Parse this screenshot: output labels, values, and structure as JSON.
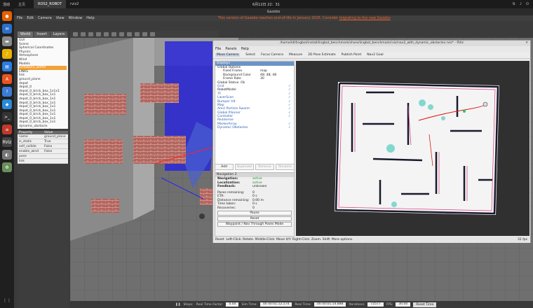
{
  "topbar": {
    "activities": "活动",
    "tabs": [
      {
        "label": "主页",
        "active": false
      },
      {
        "label": "ROS2_ROBOT",
        "active": true
      }
    ],
    "app_label": "rviz2",
    "clock": "6月12日 22：31"
  },
  "dock": {
    "apps": [
      {
        "icon": "firefox-icon",
        "color": "#e66000",
        "glyph": "●"
      },
      {
        "icon": "thunderbird-icon",
        "color": "#2a6fc9",
        "glyph": "✉"
      },
      {
        "icon": "files-icon",
        "color": "#8a8a8a",
        "glyph": "▬"
      },
      {
        "icon": "rhythmbox-icon",
        "color": "#e8b400",
        "glyph": "♪"
      },
      {
        "icon": "writer-icon",
        "color": "#2b7de0",
        "glyph": "▤"
      },
      {
        "icon": "app-center-icon",
        "color": "#e95420",
        "glyph": "A"
      },
      {
        "icon": "help-icon",
        "color": "#3b7bd6",
        "glyph": "?"
      },
      {
        "icon": "vscode-icon",
        "color": "#2c8ad8",
        "glyph": "◆"
      },
      {
        "icon": "terminal-icon",
        "color": "#333",
        "glyph": ">_"
      },
      {
        "icon": "layers-icon",
        "color": "#c0392b",
        "glyph": "≡"
      },
      {
        "icon": "rviz-icon",
        "color": "#444",
        "glyph": "RViz"
      },
      {
        "icon": "disk-icon",
        "color": "#777",
        "glyph": "◐"
      },
      {
        "icon": "trash-icon",
        "color": "#6a8f5a",
        "glyph": "♻"
      }
    ],
    "apps_grid": "⋮⋮"
  },
  "gazebo": {
    "title": "Gazebo",
    "menu": [
      "File",
      "Edit",
      "Camera",
      "View",
      "Window",
      "Help"
    ],
    "notice": "This version of Gazebo reaches end-of-life in January 2025. Consider",
    "notice_link": "migrating to the new Gazebo",
    "tabs": [
      "World",
      "Insert",
      "Layers"
    ],
    "tree": [
      "GUI",
      "Scene",
      "Spherical Coordinates",
      "Physics",
      "Atmosphere",
      "Wind",
      "Models",
      "turtlebot3_waffle",
      "LINKS",
      "link",
      "ground_plane",
      "depot",
      "depot_0",
      "depot_0_brick_box_1x1x1",
      "depot_0_brick_box_1x1",
      "depot_0_brick_box_1x1",
      "depot_0_brick_box_1x1",
      "depot_0_brick_box_1x1",
      "depot_0_brick_box_1x1",
      "depot_0_brick_box_1x1",
      "depot_0_brick_box_1x1",
      "depot_0_brick_box_1x1",
      "dynamic_obstacle",
      "dynamic_obstacle_0",
      "dynamic_obstacle_1"
    ],
    "highlighted_index": 7,
    "property_header": [
      "Property",
      "Value"
    ],
    "properties": [
      [
        "name",
        "ground_plane"
      ],
      [
        "is_static",
        "True"
      ],
      [
        "self_collide",
        "False"
      ],
      [
        "enable_wind",
        "False"
      ],
      [
        "pose",
        ""
      ],
      [
        "link",
        ""
      ]
    ],
    "status": {
      "steps_label": "Steps:",
      "rtf_label": "Real Time Factor:",
      "rtf": "0.00",
      "sim_label": "Sim Time:",
      "sim": "00 00:01:12.574",
      "real_label": "Real Time:",
      "real": "00 00:01:14.888",
      "iter_label": "Iterations:",
      "iter": "72577",
      "fps_label": "FPS:",
      "fps": "30.00",
      "reset": "Reset Time"
    }
  },
  "rviz": {
    "title": "/home/ldl/lingbot/install/lingbot_benchmark/share/lingbot_benchmark/rviz/nav2_with_dynamic_obstacles.rviz* - RViz",
    "menu": [
      "File",
      "Panels",
      "Help"
    ],
    "tools": [
      "Move Camera",
      "Select",
      "Focus Camera",
      "Measure",
      "2D Pose Estimate",
      "Publish Point",
      "Nav2 Goal"
    ],
    "displays_title": "Displays",
    "displays": [
      {
        "name": "Global Options",
        "value": "",
        "check": "",
        "kind": "head"
      },
      {
        "name": "Fixed Frame",
        "value": "map",
        "check": "",
        "kind": "sub"
      },
      {
        "name": "Background Color",
        "value": "48; 48; 48",
        "check": "",
        "kind": "sub"
      },
      {
        "name": "Frame Rate",
        "value": "30",
        "check": "",
        "kind": "sub"
      },
      {
        "name": "Global Status: Ok",
        "value": "",
        "check": "",
        "kind": "head"
      },
      {
        "name": "Grid",
        "value": "",
        "check": "✓",
        "kind": "blue"
      },
      {
        "name": "RobotModel",
        "value": "",
        "check": "✓",
        "kind": "plain"
      },
      {
        "name": "TF",
        "value": "",
        "check": "✓",
        "kind": "blue"
      },
      {
        "name": "LaserScan",
        "value": "",
        "check": "✓",
        "kind": "blue"
      },
      {
        "name": "Bumper Hit",
        "value": "",
        "check": "✓",
        "kind": "blue"
      },
      {
        "name": "Map",
        "value": "",
        "check": "✓",
        "kind": "blue"
      },
      {
        "name": "Amcl Particle Swarm",
        "value": "",
        "check": "✓",
        "kind": "blue"
      },
      {
        "name": "Global Planner",
        "value": "",
        "check": "✓",
        "kind": "blue"
      },
      {
        "name": "Controller",
        "value": "",
        "check": "✓",
        "kind": "blue"
      },
      {
        "name": "Realsense",
        "value": "",
        "check": "",
        "kind": "blue"
      },
      {
        "name": "MarkerArray",
        "value": "",
        "check": "✓",
        "kind": "blue"
      },
      {
        "name": "Dynamic Obstacles",
        "value": "",
        "check": "✓",
        "kind": "blue"
      }
    ],
    "display_buttons": [
      {
        "label": "Add",
        "enabled": true
      },
      {
        "label": "Duplicate",
        "enabled": false
      },
      {
        "label": "Remove",
        "enabled": false
      },
      {
        "label": "Rename",
        "enabled": false
      }
    ],
    "nav": {
      "title": "Navigation 2",
      "navigation_label": "Navigation:",
      "navigation": "active",
      "localization_label": "Localization:",
      "localization": "active",
      "feedback_label": "Feedback:",
      "feedback": "unknown",
      "metrics": [
        [
          "Poses remaining:",
          "0"
        ],
        [
          "ETA:",
          "0 s"
        ],
        [
          "Distance remaining:",
          "0.00 m"
        ],
        [
          "Time taken:",
          "0 s"
        ],
        [
          "Recoveries:",
          "0"
        ]
      ],
      "pause": "Pause",
      "reset": "Reset",
      "waypoint": "Waypoint / Nav Through Poses Mode"
    },
    "status": {
      "reset": "Reset",
      "hint": "Left-Click: Rotate. Middle-Click: Move X/Y. Right-Click: Zoom. Shift: More options.",
      "fps": "31 fps"
    }
  }
}
